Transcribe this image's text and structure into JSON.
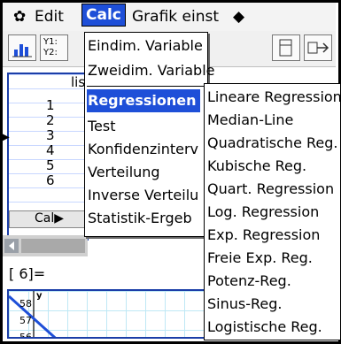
{
  "menubar": {
    "gear_icon": "gear-icon",
    "items": [
      "Edit",
      "Calc",
      "Grafik einst"
    ],
    "more_glyph": "◆"
  },
  "toolbar": {
    "btn2_top": "Y1:",
    "btn2_bottom": "Y2:"
  },
  "list": {
    "header_partial": "lis",
    "rows": [
      "1",
      "2",
      "3",
      "4",
      "5",
      "6"
    ],
    "cal_label": "Cal▶"
  },
  "cell_ref": "[  6]=",
  "graph": {
    "y_axis_symbol": "y",
    "tick_labels": [
      "58",
      "57",
      "56"
    ]
  },
  "calc_menu": {
    "items": [
      "Eindim. Variable",
      "Zweidim. Variable",
      "Regressionen",
      "Test",
      "Konfidenzinterv",
      "Verteilung",
      "Inverse Verteilu",
      "Statistik-Ergeb"
    ]
  },
  "regressionen_submenu": {
    "items": [
      "Lineare Regression",
      "Median-Line",
      "Quadratische Reg.",
      "Kubische Reg.",
      "Quart. Regression",
      "Log. Regression",
      "Exp. Regression",
      "Freie Exp. Reg.",
      "Potenz-Reg.",
      "Sinus-Reg.",
      "Logistische Reg."
    ]
  },
  "colors": {
    "accent": "#1e4fd8",
    "window_border": "#1b3ea8",
    "graph_grid": "#bfe8f5"
  }
}
